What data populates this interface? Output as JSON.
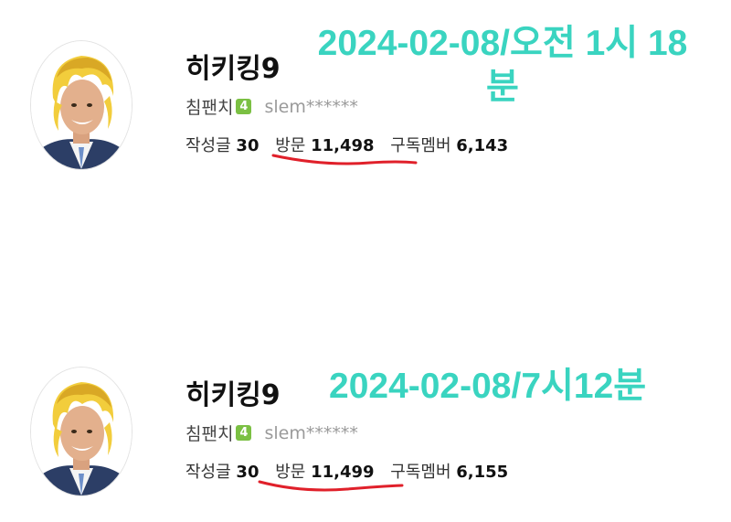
{
  "profiles": [
    {
      "nickname": "히키킹9",
      "grade_label": "침팬치",
      "grade_level": "4",
      "user_id": "slem******",
      "posts_label": "작성글",
      "posts_value": "30",
      "visits_label": "방문",
      "visits_value": "11,498",
      "members_label": "구독멤버",
      "members_value": "6,143",
      "annotation": "2024-02-08/오전 1시 18분"
    },
    {
      "nickname": "히키킹9",
      "grade_label": "침팬치",
      "grade_level": "4",
      "user_id": "slem******",
      "posts_label": "작성글",
      "posts_value": "30",
      "visits_label": "방문",
      "visits_value": "11,499",
      "members_label": "구독멤버",
      "members_value": "6,155",
      "annotation": "2024-02-08/7시12분"
    }
  ],
  "colors": {
    "annotation": "#3ad4c0",
    "underline": "#e0202a",
    "grade_badge": "#7bc043"
  },
  "icons": {
    "avatar": "cartoon-blond-man-avatar"
  }
}
